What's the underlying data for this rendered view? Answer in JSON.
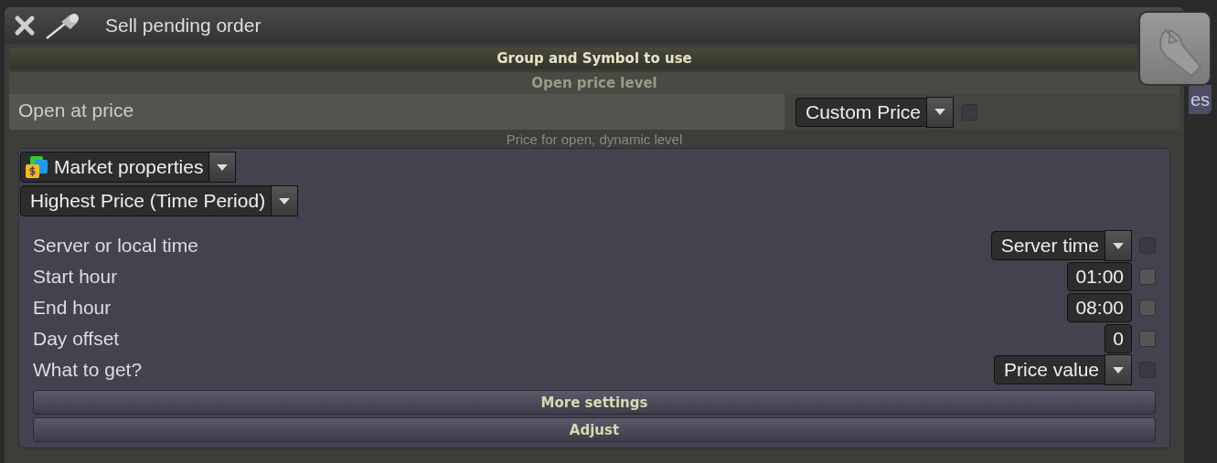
{
  "window": {
    "title": "Sell pending order"
  },
  "side_tab": {
    "label": "es"
  },
  "sections": [
    {
      "title": "Group and Symbol to use",
      "kind": "group"
    },
    {
      "title": "Open price level",
      "kind": "sub"
    }
  ],
  "open_at_price": {
    "label": "Open at price",
    "value": "Custom Price",
    "hint": "Price for open, dynamic level",
    "checkbox": {
      "checked": false,
      "disabled": true
    }
  },
  "source": {
    "value": "Market properties"
  },
  "function": {
    "value": "Highest Price (Time Period)"
  },
  "parameters": [
    {
      "label": "Server or local time",
      "kind": "dropdown",
      "value": "Server time",
      "checked": false,
      "disabled": true
    },
    {
      "label": "Start hour",
      "kind": "number",
      "value": "01:00",
      "checked": false,
      "disabled": false
    },
    {
      "label": "End hour",
      "kind": "number",
      "value": "08:00",
      "checked": false,
      "disabled": false
    },
    {
      "label": "Day offset",
      "kind": "number",
      "value": "0",
      "checked": false,
      "disabled": false
    },
    {
      "label": "What to get?",
      "kind": "dropdown",
      "value": "Price value",
      "checked": false,
      "disabled": true
    }
  ],
  "buttons": [
    {
      "label": "More settings"
    },
    {
      "label": "Adjust"
    }
  ]
}
